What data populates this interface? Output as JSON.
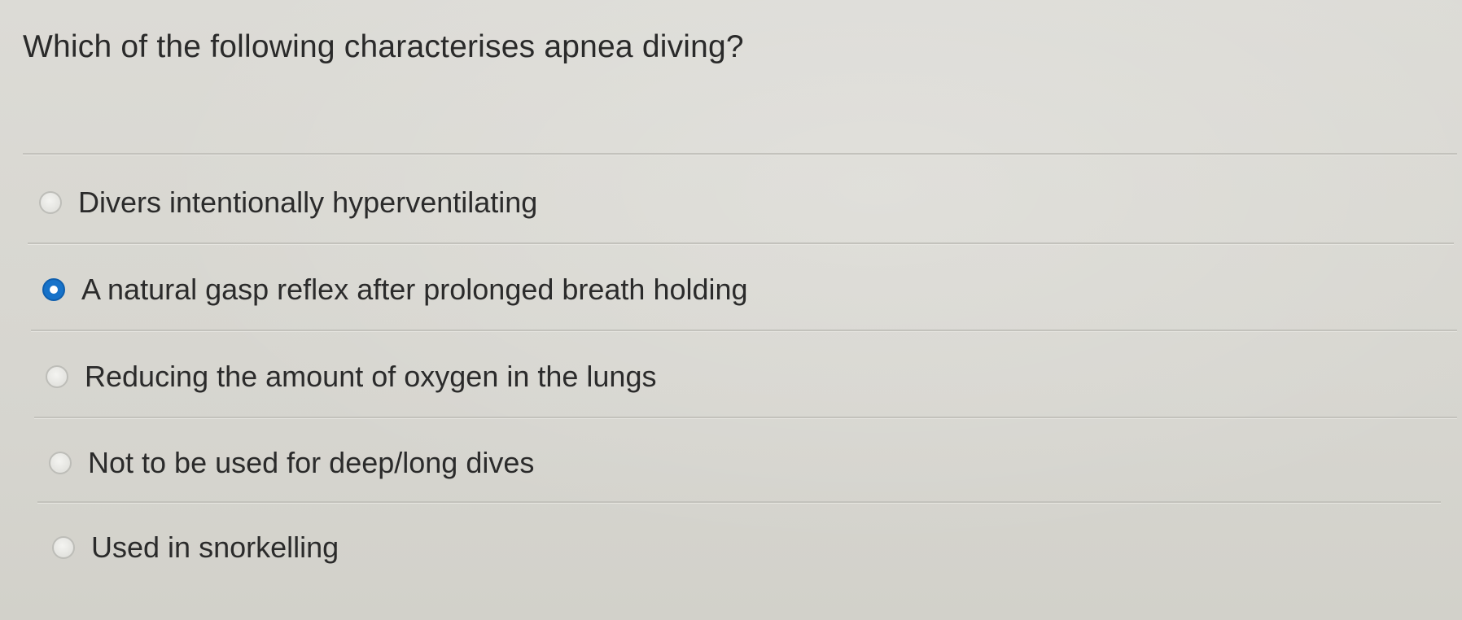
{
  "question": {
    "text": "Which of the following characterises apnea diving?"
  },
  "options": [
    {
      "label": "Divers intentionally hyperventilating",
      "selected": false
    },
    {
      "label": "A natural gasp reflex after prolonged breath holding",
      "selected": true
    },
    {
      "label": "Reducing the amount of oxygen in the lungs",
      "selected": false
    },
    {
      "label": "Not to be used for deep/long dives",
      "selected": false
    },
    {
      "label": "Used in snorkelling",
      "selected": false
    }
  ],
  "colors": {
    "background": "#d9d8d2",
    "text": "#2b2b2b",
    "radio_selected": "#1672c9",
    "divider": "#c3c2bc"
  }
}
